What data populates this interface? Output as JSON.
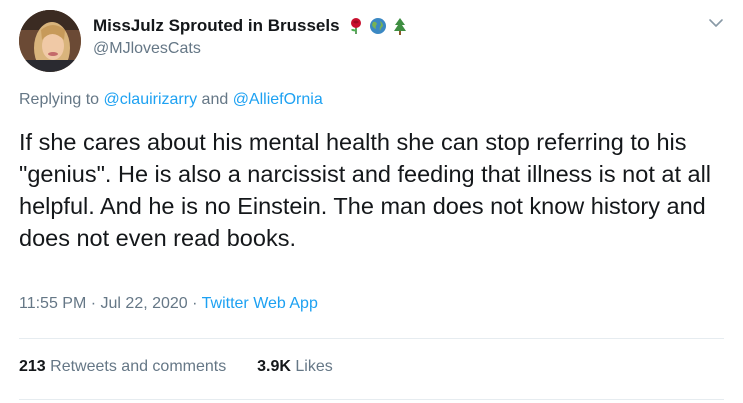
{
  "author": {
    "display_name": "MissJulz Sprouted in Brussels",
    "handle": "@MJlovesCats",
    "emojis": [
      "rose-emoji",
      "globe-emoji",
      "evergreen-tree-emoji"
    ]
  },
  "reply": {
    "prefix": "Replying to ",
    "mention_1": "@clauirizarry",
    "conjunction": " and ",
    "mention_2": "@AlliefOrnia"
  },
  "tweet": {
    "text": "If she cares about his mental health she can stop referring to his \"genius\".  He is also a narcissist and feeding that illness is not at all helpful.  And he is no Einstein.  The man does not know history and does not even read books."
  },
  "meta": {
    "time": "11:55 PM",
    "separator_1": " · ",
    "date": "Jul 22, 2020",
    "separator_2": " · ",
    "source": "Twitter Web App"
  },
  "stats": {
    "retweets_count": "213",
    "retweets_label": " Retweets and comments",
    "likes_count": "3.9K",
    "likes_label": " Likes"
  },
  "colors": {
    "link": "#1da1f2",
    "secondary_text": "#657786",
    "primary_text": "#14171a",
    "divider": "#e6ecf0"
  }
}
